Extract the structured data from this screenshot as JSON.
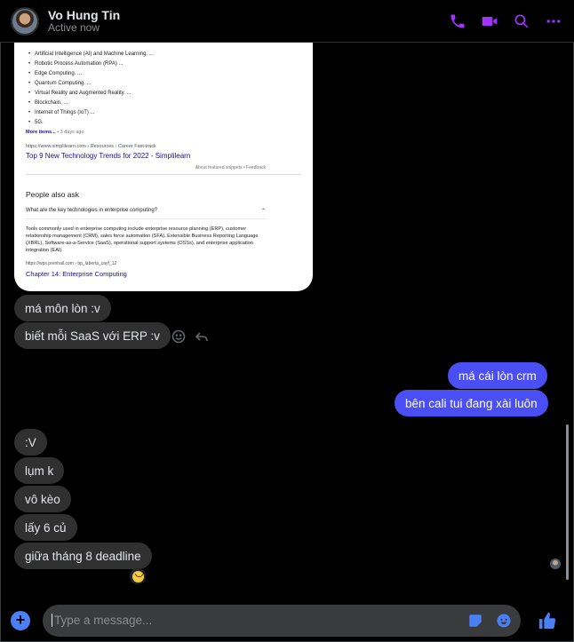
{
  "header": {
    "name": "Vo Hung Tin",
    "status": "Active now",
    "icons": [
      "phone-icon",
      "video-icon",
      "search-icon",
      "more-icon"
    ]
  },
  "preview": {
    "list": [
      "Artificial Intelligence (AI) and Machine Learning. ...",
      "Robotic Process Automation (RPA) ...",
      "Edge Computing. ...",
      "Quantum Computing. ...",
      "Virtual Reality and Augmented Reality. ...",
      "Blockchain. ...",
      "Internet of Things (IoT) ...",
      "5G."
    ],
    "more": "More items...",
    "more_time": "• 3 days ago",
    "url": "https://www.simplilearn.com › Resources › Career Fast-track",
    "link": "Top 9 New Technology Trends for 2022 - Simplilearn",
    "feedback": "About featured snippets   •   Feedback",
    "paa_title": "People also ask",
    "question": "What are the key technologies in enterprise computing?",
    "answer": "Tools commonly used in enterprise computing include enterprise resource planning (ERP), customer relationship management (CRM), sales force automation (SFA), Extensible Business Reporting Language (XBRL), Software-as-a-Service (SaaS), operational support systems (OSSs), and enterprise application integration (EAI).",
    "source": "https://wps.prenhall.com › bp_laberta_cayf_12",
    "link2": "Chapter 14: Enterprise Computing"
  },
  "messages": {
    "in1": "má môn lòn :v",
    "in2": "biết mỗi SaaS với ERP :v",
    "out1": "má cái lòn crm",
    "out2": "bên cali tui đang xài luôn",
    "in3": ":V",
    "in4": "lụm k",
    "in5": "vô kèo",
    "in6": "lấy 6 củ",
    "in7": "giữa tháng 8 deadline"
  },
  "composer": {
    "placeholder": "Type a message..."
  },
  "colors": {
    "accent": "#a033ff",
    "outgoing": "#4a4ff5",
    "composer_icons": "#4a7ff5"
  }
}
